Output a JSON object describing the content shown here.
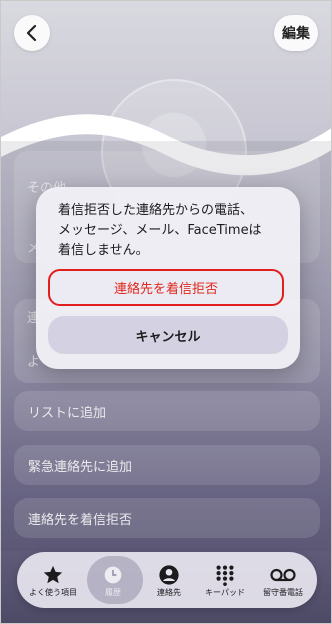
{
  "header": {
    "edit_label": "編集"
  },
  "background": {
    "partial_label_1": "その他",
    "partial_label_2": "メ",
    "partial_label_3": "連",
    "partial_label_4": "よ",
    "rows": [
      "リストに追加",
      "緊急連絡先に追加",
      "連絡先を着信拒否"
    ]
  },
  "alert": {
    "message": "着信拒否した連絡先からの電話、\nメッセージ、メール、FaceTimeは\n着信しません。",
    "block_label": "連絡先を着信拒否",
    "cancel_label": "キャンセル"
  },
  "tabbar": {
    "tabs": [
      {
        "label": "よく使う項目",
        "icon": "star-icon"
      },
      {
        "label": "履歴",
        "icon": "clock-icon"
      },
      {
        "label": "連絡先",
        "icon": "person-icon"
      },
      {
        "label": "キーパッド",
        "icon": "keypad-icon"
      },
      {
        "label": "留守番電話",
        "icon": "voicemail-icon"
      }
    ]
  },
  "colors": {
    "destructive": "#e0281e",
    "highlight_border": "#e21d1d"
  }
}
